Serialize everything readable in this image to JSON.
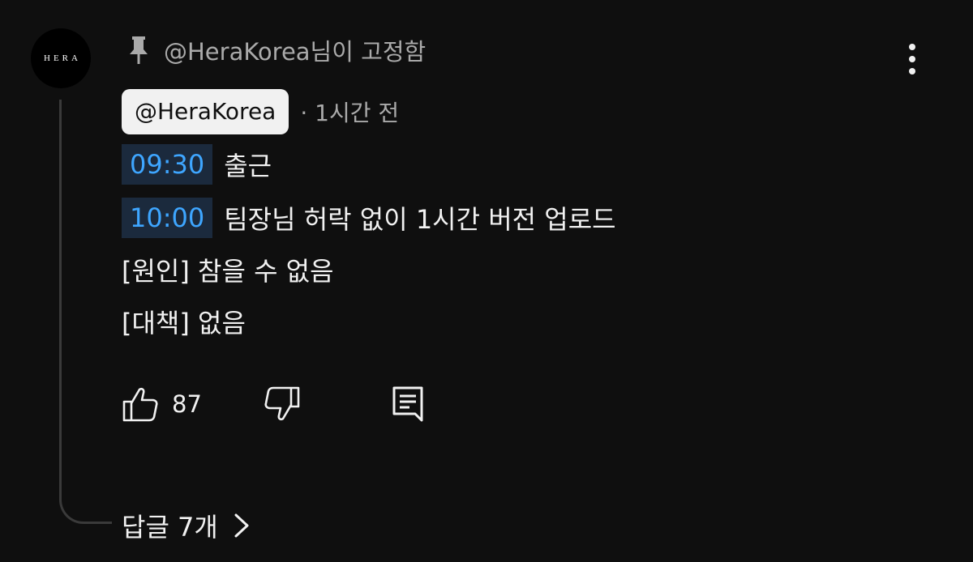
{
  "avatar": {
    "text": "HERA"
  },
  "pinned": {
    "label": "@HeraKorea님이 고정함",
    "icon": "pin-icon"
  },
  "author": {
    "handle": "@HeraKorea",
    "time": "· 1시간 전"
  },
  "comment": {
    "lines": [
      {
        "timestamp": "09:30",
        "text": "출근"
      },
      {
        "timestamp": "10:00",
        "text": "팀장님 허락 없이 1시간 버전 업로드"
      },
      {
        "text": "[원인] 참을 수 없음"
      },
      {
        "text": "[대책] 없음"
      }
    ]
  },
  "actions": {
    "like_count": "87",
    "icons": [
      "like-icon",
      "dislike-icon",
      "reply-icon"
    ]
  },
  "replies": {
    "label": "답글 7개"
  },
  "colors": {
    "background": "#0f0f0f",
    "timestamp_link": "#3ea6ff",
    "timestamp_bg": "#1b2a3d",
    "muted": "#aaaaaa"
  }
}
